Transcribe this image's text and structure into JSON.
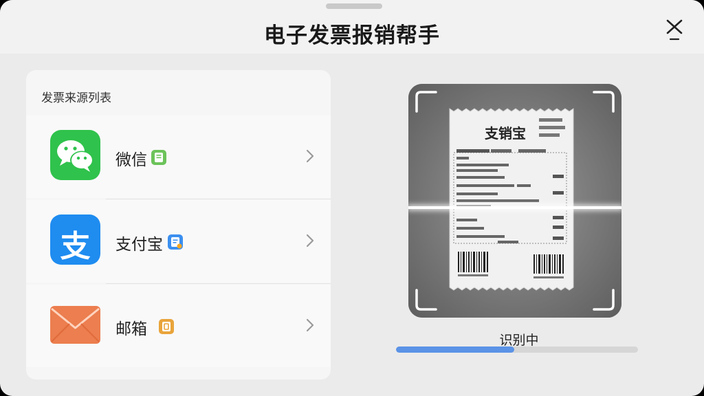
{
  "header": {
    "title": "电子发票报销帮手"
  },
  "sources": {
    "title": "发票来源列表",
    "items": [
      {
        "label": "微信",
        "icon": "wechat-icon"
      },
      {
        "label": "支付宝",
        "icon": "alipay-icon",
        "glyph": "支"
      },
      {
        "label": "邮箱",
        "icon": "mail-icon"
      }
    ]
  },
  "scanner": {
    "receipt_title": "支销宝"
  },
  "status": {
    "text": "识别中",
    "progress": 0.49
  },
  "colors": {
    "wechat": "#2fc24c",
    "alipay": "#1f8cf0",
    "mail": "#ec7e4f",
    "progress": "#5b93e6"
  }
}
